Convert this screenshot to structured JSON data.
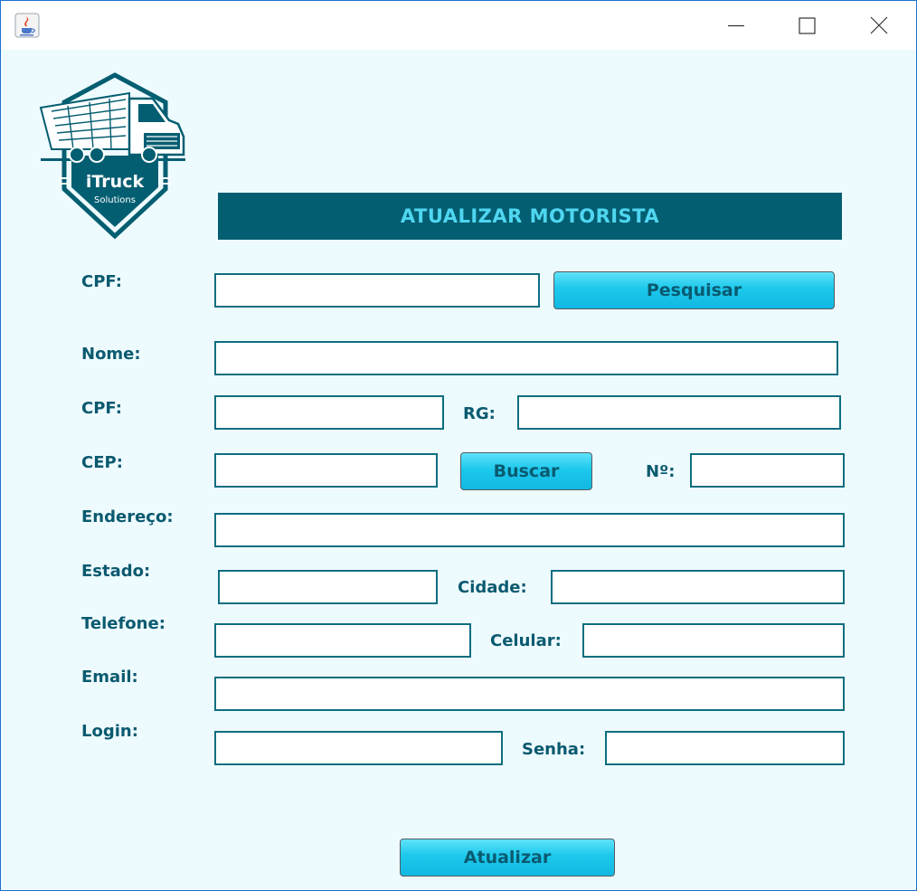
{
  "window": {
    "icon": "java-coffee-icon",
    "controls": [
      "minimize-icon",
      "maximize-icon",
      "close-icon"
    ]
  },
  "logo": {
    "brand": "iTruck",
    "tagline": "Solutions",
    "icon": "truck-icon",
    "color": "#045e71"
  },
  "header": {
    "title": "ATUALIZAR MOTORISTA"
  },
  "search": {
    "cpf_label": "CPF:",
    "cpf_value": "",
    "button_label": "Pesquisar"
  },
  "form": {
    "nome_label": "Nome:",
    "cpf_label": "CPF:",
    "rg_label": "RG:",
    "cep_label": "CEP:",
    "buscar_label": "Buscar",
    "numero_label": "Nº:",
    "endereco_label": "Endereço:",
    "estado_label": "Estado:",
    "cidade_label": "Cidade:",
    "telefone_label": "Telefone:",
    "celular_label": "Celular:",
    "email_label": "Email:",
    "login_label": "Login:",
    "senha_label": "Senha:",
    "values": {
      "nome": "",
      "cpf": "",
      "rg": "",
      "cep": "",
      "numero": "",
      "endereco": "",
      "estado": "",
      "cidade": "",
      "telefone": "",
      "celular": "",
      "email": "",
      "login": "",
      "senha": ""
    }
  },
  "footer": {
    "update_button_label": "Atualizar"
  },
  "colors": {
    "accent": "#045e71",
    "label": "#0a5a70",
    "button": "#1cc8ec",
    "background": "#eefbfe",
    "title_text": "#4fd6f0"
  }
}
